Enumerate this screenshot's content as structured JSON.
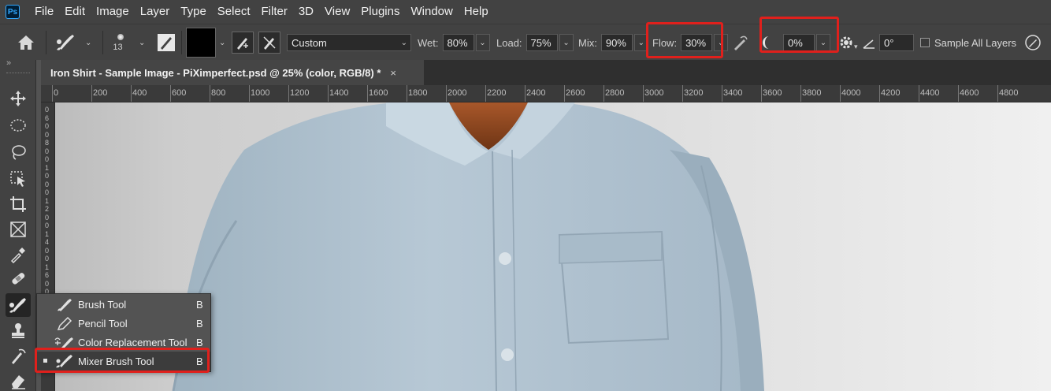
{
  "app": {
    "logo": "Ps"
  },
  "menu": [
    "File",
    "Edit",
    "Image",
    "Layer",
    "Type",
    "Select",
    "Filter",
    "3D",
    "View",
    "Plugins",
    "Window",
    "Help"
  ],
  "options": {
    "brush_size": "13",
    "preset": "Custom",
    "wet_label": "Wet:",
    "wet_value": "80%",
    "load_label": "Load:",
    "load_value": "75%",
    "mix_label": "Mix:",
    "mix_value": "90%",
    "flow_label": "Flow:",
    "flow_value": "30%",
    "smoothing_value": "0%",
    "angle_value": "0°",
    "sample_all_layers": "Sample All Layers",
    "foreground_color": "#000000",
    "highlight_color": "#e0201c"
  },
  "document": {
    "tab_title": "Iron Shirt - Sample Image - PiXimperfect.psd @ 25% (color, RGB/8) *",
    "close": "×"
  },
  "ruler_top": [
    "0",
    "200",
    "400",
    "600",
    "800",
    "1000",
    "1200",
    "1400",
    "1600",
    "1800",
    "2000",
    "2200",
    "2400",
    "2600",
    "2800",
    "3000",
    "3200",
    "3400",
    "3600",
    "3800",
    "4000",
    "4200",
    "4400",
    "4600",
    "4800"
  ],
  "ruler_left": [
    "0",
    "6",
    "0",
    "0",
    "8",
    "0",
    "0",
    "1",
    "0",
    "0",
    "0",
    "1",
    "2",
    "0",
    "0",
    "1",
    "4",
    "0",
    "0",
    "1",
    "6",
    "0",
    "0",
    "1",
    "8",
    "0"
  ],
  "flyout": {
    "items": [
      {
        "label": "Brush Tool",
        "key": "B",
        "icon": "brush-icon"
      },
      {
        "label": "Pencil Tool",
        "key": "B",
        "icon": "pencil-icon"
      },
      {
        "label": "Color Replacement Tool",
        "key": "B",
        "icon": "color-replacement-icon"
      },
      {
        "label": "Mixer Brush Tool",
        "key": "B",
        "icon": "mixer-brush-icon"
      }
    ]
  }
}
